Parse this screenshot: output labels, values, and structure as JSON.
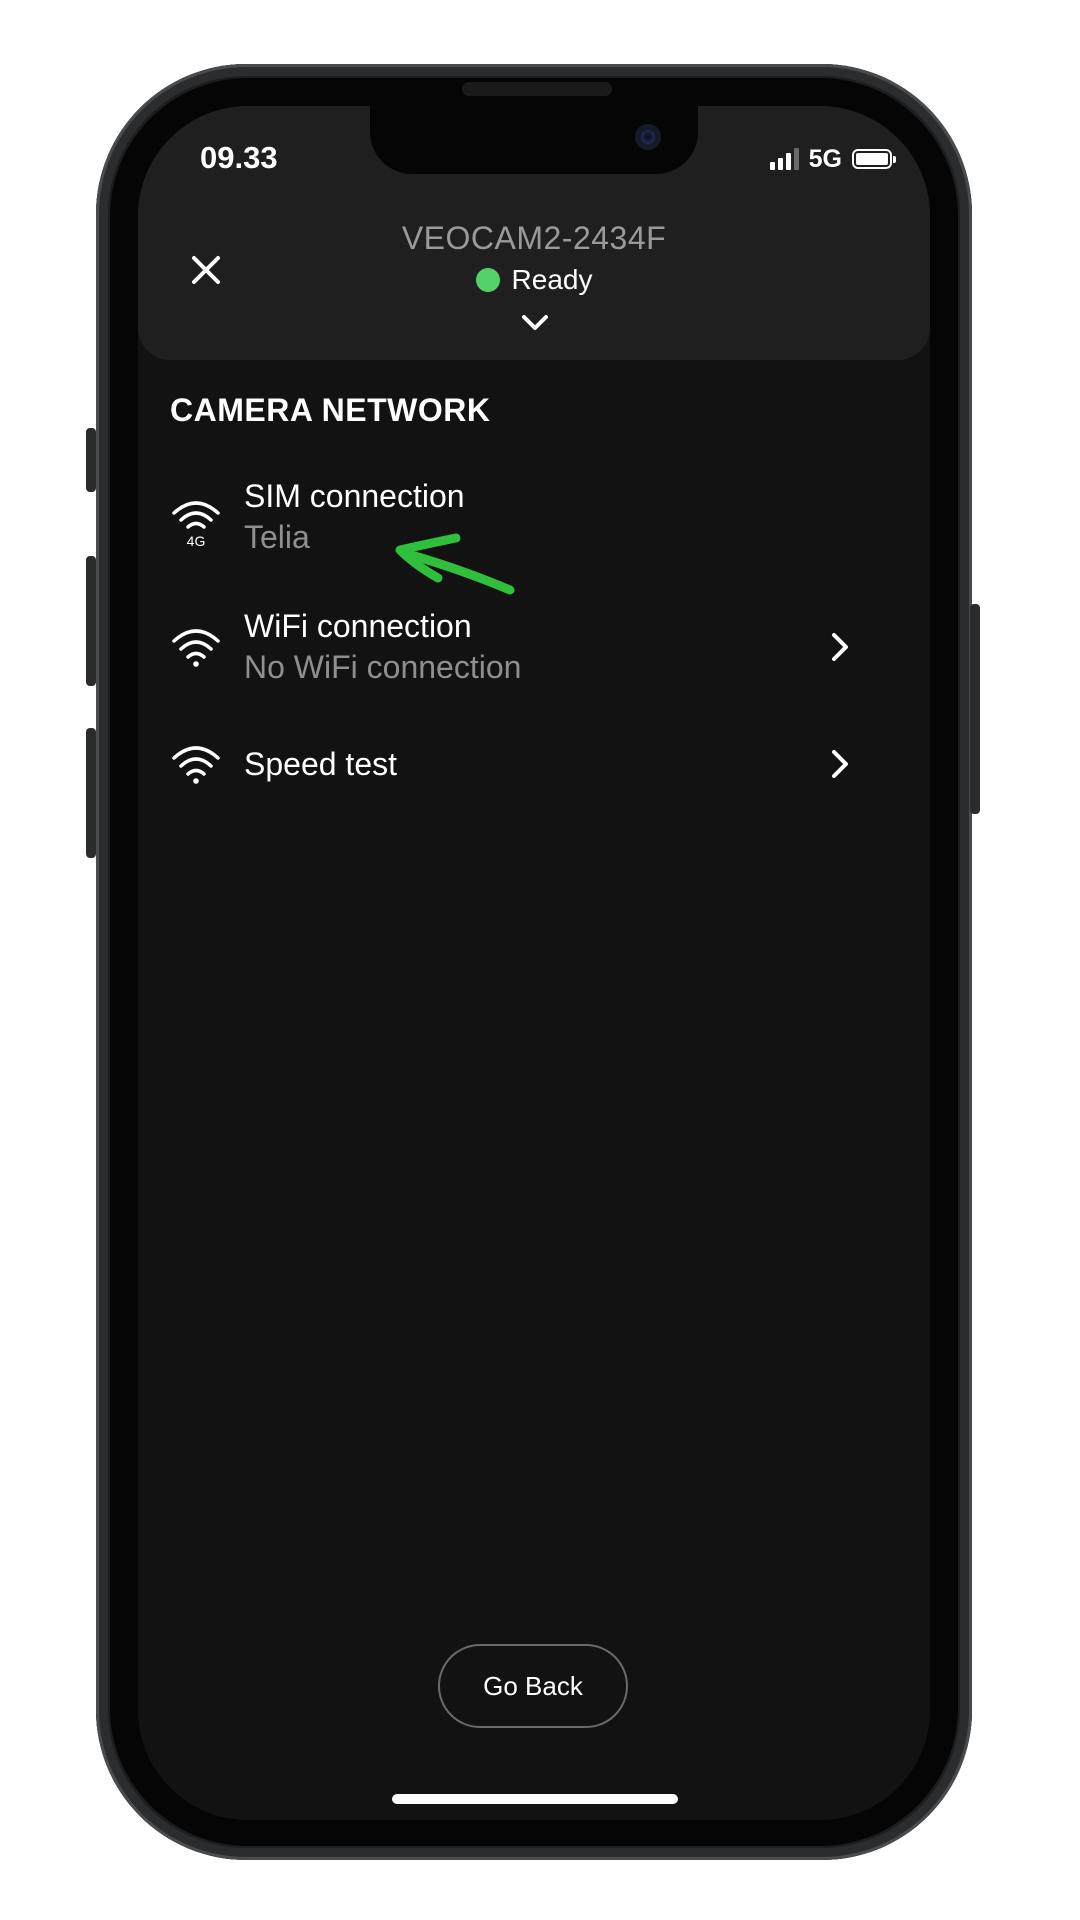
{
  "status_bar": {
    "time": "09.33",
    "network": "5G",
    "signal_bars": 3,
    "battery_level": 1.0
  },
  "header": {
    "close_icon": "close-icon",
    "device_name": "VEOCAM2-2434F",
    "status_text": "Ready",
    "status_color": "#54d06a",
    "expand_icon": "chevron-down-icon"
  },
  "section": {
    "title": "CAMERA NETWORK"
  },
  "network_items": [
    {
      "icon": "wifi-4g-icon",
      "badge": "4G",
      "title": "SIM connection",
      "subtitle": "Telia",
      "has_chevron": false
    },
    {
      "icon": "wifi-icon",
      "title": "WiFi connection",
      "subtitle": "No WiFi connection",
      "has_chevron": true
    },
    {
      "icon": "wifi-icon",
      "title": "Speed test",
      "has_chevron": true
    }
  ],
  "annotation": {
    "icon": "green-arrow-annotation",
    "color": "#2fbf3a"
  },
  "footer": {
    "go_back_label": "Go Back"
  }
}
